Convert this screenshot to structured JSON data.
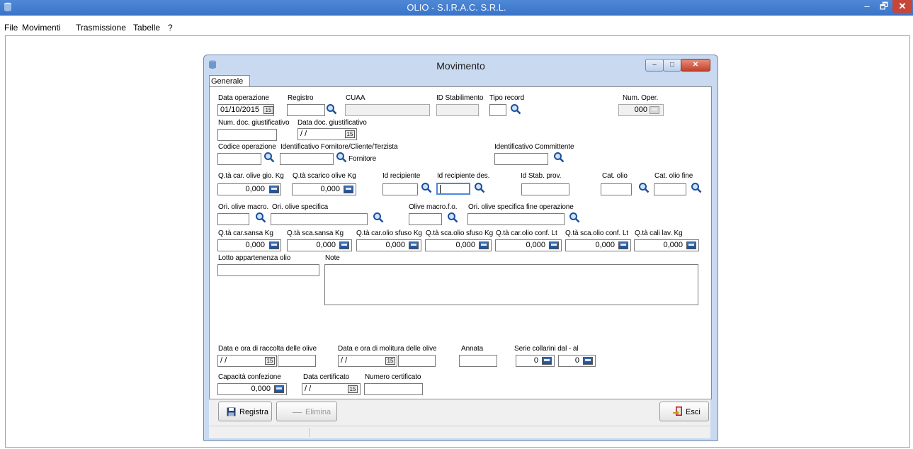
{
  "window": {
    "title": "OLIO - S.I.R.A.C. S.R.L.",
    "min": "–",
    "max": "🗗",
    "close": "✕"
  },
  "menu": {
    "items": [
      "File",
      "Movimenti",
      "Trasmissione",
      "Tabelle",
      "?"
    ]
  },
  "dialog": {
    "title": "Movimento",
    "min": "–",
    "max": "□",
    "close": "✕",
    "tab": "Generale",
    "calendar_glyph": "15",
    "fields": {
      "data_operazione": {
        "label": "Data operazione",
        "value": "01/10/2015"
      },
      "registro": {
        "label": "Registro",
        "value": ""
      },
      "cuaa": {
        "label": "CUAA",
        "value": ""
      },
      "id_stabilimento": {
        "label": "ID Stabilimento",
        "value": ""
      },
      "tipo_record": {
        "label": "Tipo record",
        "value": ""
      },
      "num_oper": {
        "label": "Num. Oper.",
        "value": "000"
      },
      "num_doc": {
        "label": "Num. doc. giustificativo",
        "value": ""
      },
      "data_doc": {
        "label": "Data doc. giustificativo",
        "value": "/ /"
      },
      "codice_operazione": {
        "label": "Codice operazione",
        "value": ""
      },
      "identificativo_fornitore": {
        "label": "Identificativo Fornitore/Cliente/Terzista",
        "value": "",
        "suffix": "Fornitore"
      },
      "identificativo_committente": {
        "label": "Identificativo Committente",
        "value": ""
      },
      "qta_car_olive": {
        "label": "Q.tà car. olive gio. Kg",
        "value": "0,000"
      },
      "qta_scarico_olive": {
        "label": "Q.tà scarico olive Kg",
        "value": "0,000"
      },
      "id_recipiente": {
        "label": "Id recipiente",
        "value": ""
      },
      "id_recipiente_des": {
        "label": "Id recipiente des.",
        "value": ""
      },
      "id_stab_prov": {
        "label": "Id Stab. prov.",
        "value": ""
      },
      "cat_olio": {
        "label": "Cat. olio",
        "value": ""
      },
      "cat_olio_fine": {
        "label": "Cat. olio fine",
        "value": ""
      },
      "ori_olive_macro": {
        "label": "Ori. olive macro.",
        "value": ""
      },
      "ori_olive_specifica": {
        "label": "Ori. olive specifica",
        "value": ""
      },
      "olive_macro_fo": {
        "label": "Olive macro.f.o.",
        "value": ""
      },
      "ori_olive_spec_fine": {
        "label": "Ori. olive specifica fine operazione",
        "value": ""
      },
      "qta_car_sansa": {
        "label": "Q.tà car.sansa Kg",
        "value": "0,000"
      },
      "qta_sca_sansa": {
        "label": "Q.tà sca.sansa Kg",
        "value": "0,000"
      },
      "qta_car_olio_sfuso": {
        "label": "Q.tà car.olio sfuso Kg",
        "value": "0,000"
      },
      "qta_sca_olio_sfuso": {
        "label": "Q.tà sca.olio sfuso Kg",
        "value": "0,000"
      },
      "qta_car_olio_conf": {
        "label": "Q.tà car.olio conf. Lt",
        "value": "0,000"
      },
      "qta_sca_olio_conf": {
        "label": "Q.tà sca.olio conf. Lt",
        "value": "0,000"
      },
      "qta_cali_lav": {
        "label": "Q.tà cali lav. Kg",
        "value": "0,000"
      },
      "lotto_appartenenza": {
        "label": "Lotto appartenenza olio",
        "value": ""
      },
      "note": {
        "label": "Note",
        "value": ""
      },
      "data_raccolta": {
        "label": "Data e ora di raccolta delle olive",
        "value": "/ /",
        "time": ""
      },
      "data_molitura": {
        "label": "Data e ora di molitura delle olive",
        "value": "/ /",
        "time": ""
      },
      "annata": {
        "label": "Annata",
        "value": ""
      },
      "serie_collarini": {
        "label": "Serie collarini dal - al",
        "from": "0",
        "to": "0"
      },
      "capacita_confezione": {
        "label": "Capacità confezione",
        "value": "0,000"
      },
      "data_certificato": {
        "label": "Data certificato",
        "value": "/ /"
      },
      "numero_certificato": {
        "label": "Numero certificato",
        "value": ""
      }
    },
    "buttons": {
      "registra": "Registra",
      "elimina": "Elimina",
      "esci": "Esci"
    }
  },
  "colors": {
    "titlebar": "#3a74c8",
    "dialog_frame": "#c9daf0",
    "panel": "#ffffff"
  }
}
